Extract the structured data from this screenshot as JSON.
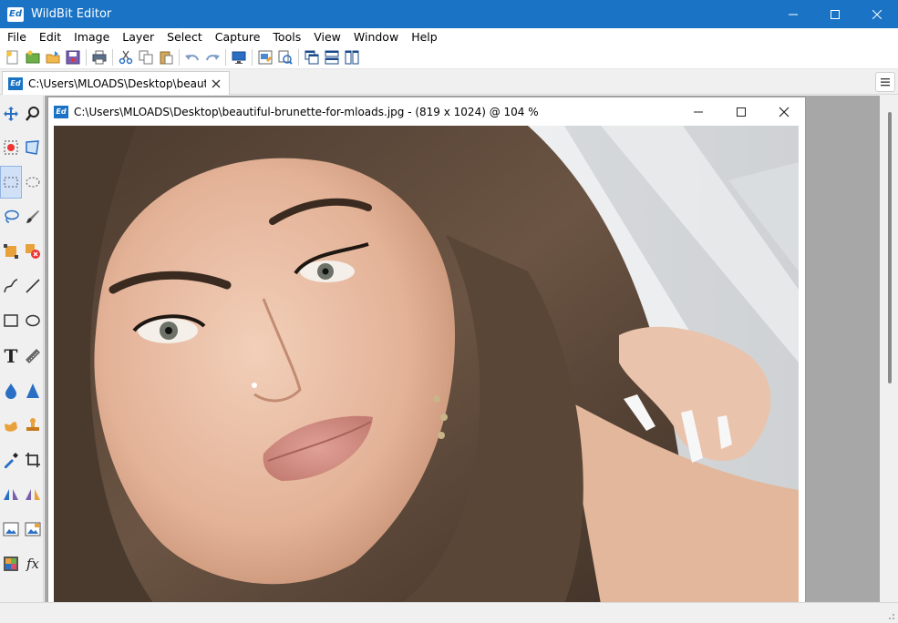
{
  "app": {
    "logo_text": "Ed",
    "title": "WildBit Editor"
  },
  "menu": [
    "File",
    "Edit",
    "Image",
    "Layer",
    "Select",
    "Capture",
    "Tools",
    "View",
    "Window",
    "Help"
  ],
  "toolbar_icons": [
    "new-icon",
    "open-icon",
    "open-folder-icon",
    "save-icon",
    "print-icon",
    "cut-icon",
    "copy-icon",
    "paste-icon",
    "undo-icon",
    "redo-icon",
    "slideshow-icon",
    "image-properties-icon",
    "batch-icon",
    "cascade-windows-icon",
    "tile-horizontal-icon",
    "tile-vertical-icon"
  ],
  "tab": {
    "label": "C:\\Users\\MLOADS\\Desktop\\beautif...",
    "close": "✕"
  },
  "tools": [
    "move-tool-icon",
    "zoom-tool-icon",
    "stamp-selection-icon",
    "transform-icon",
    "rect-select-icon",
    "ellipse-select-icon",
    "lasso-icon",
    "brush-icon",
    "crop-select-icon",
    "delete-selection-icon",
    "curve-icon",
    "line-icon",
    "rectangle-icon",
    "ellipse-icon",
    "text-icon",
    "ruler-icon",
    "blur-icon",
    "sharpen-icon",
    "smudge-icon",
    "stamp-icon",
    "eyedropper-icon",
    "crop-icon",
    "flip-horizontal-icon",
    "flip-vertical-icon",
    "resize-image-icon",
    "canvas-size-icon",
    "color-adjust-icon",
    "effects-icon"
  ],
  "effects_label": "fx",
  "text_tool_label": "T",
  "child_window": {
    "logo_text": "Ed",
    "title": "C:\\Users\\MLOADS\\Desktop\\beautiful-brunette-for-mloads.jpg - (819 x 1024) @ 104 %"
  },
  "colors": {
    "titlebar": "#1a73c4",
    "accent": "#1a73c4",
    "workspace": "#a7a7a7"
  }
}
